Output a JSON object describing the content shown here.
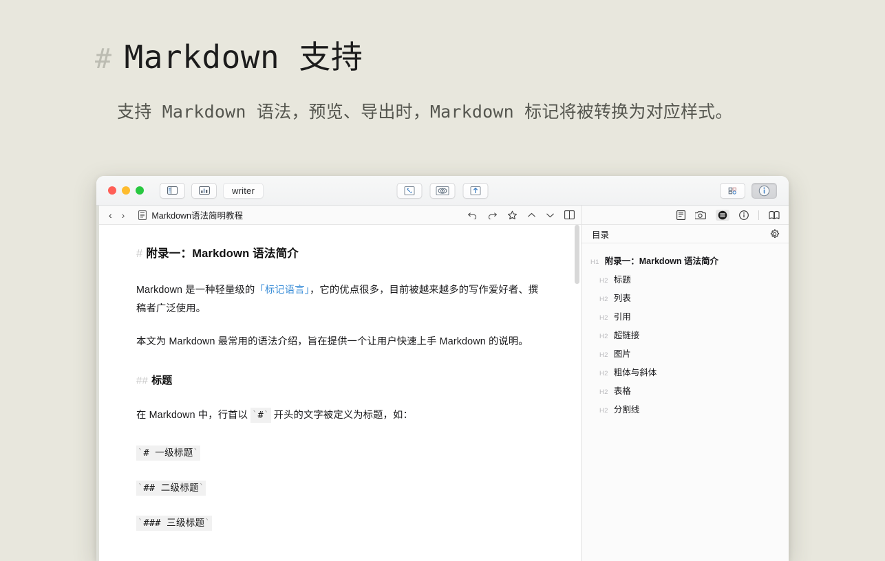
{
  "promo": {
    "hash": "#",
    "title": "Markdown 支持",
    "subtitle": "支持 Markdown 语法，预览、导出时，Markdown 标记将被转换为对应样式。"
  },
  "titlebar": {
    "traffic_lights": [
      {
        "name": "close",
        "color": "#ff5f57"
      },
      {
        "name": "minimize",
        "color": "#febc2e"
      },
      {
        "name": "zoom",
        "color": "#28c840"
      }
    ],
    "left_buttons": [
      {
        "icon": "sidebar-toggle-icon",
        "label": ""
      },
      {
        "icon": "statistics-icon",
        "label": ""
      }
    ],
    "mode_label": "writer",
    "center_buttons": [
      {
        "icon": "focus-mode-icon"
      },
      {
        "icon": "preview-eye-icon"
      },
      {
        "icon": "export-upload-icon"
      }
    ],
    "right_buttons": [
      {
        "icon": "grid-layout-icon",
        "active": false
      },
      {
        "icon": "info-circle-icon",
        "active": true
      }
    ]
  },
  "doc_toolbar": {
    "back_arrow": "‹",
    "forward_arrow": "›",
    "doc_icon": "document-icon",
    "doc_title": "Markdown语法简明教程",
    "tools": [
      {
        "icon": "undo-icon"
      },
      {
        "icon": "redo-icon"
      },
      {
        "icon": "star-icon"
      },
      {
        "icon": "chevron-up-icon"
      },
      {
        "icon": "chevron-down-icon"
      },
      {
        "icon": "split-panel-icon"
      }
    ]
  },
  "toc_toolbar": {
    "tools": [
      {
        "icon": "note-icon",
        "active": false
      },
      {
        "icon": "camera-icon",
        "active": false
      },
      {
        "icon": "outline-icon",
        "active": true
      },
      {
        "icon": "info-circle-icon",
        "active": false
      },
      {
        "icon": "map-icon",
        "active": false
      }
    ]
  },
  "toc": {
    "title": "目录",
    "settings_icon": "gear-icon",
    "items": [
      {
        "tag": "H1",
        "label": "附录一：Markdown 语法简介",
        "level": 1
      },
      {
        "tag": "H2",
        "label": "标题",
        "level": 2
      },
      {
        "tag": "H2",
        "label": "列表",
        "level": 2
      },
      {
        "tag": "H2",
        "label": "引用",
        "level": 2
      },
      {
        "tag": "H2",
        "label": "超链接",
        "level": 2
      },
      {
        "tag": "H2",
        "label": "图片",
        "level": 2
      },
      {
        "tag": "H2",
        "label": "粗体与斜体",
        "level": 2
      },
      {
        "tag": "H2",
        "label": "表格",
        "level": 2
      },
      {
        "tag": "H2",
        "label": "分割线",
        "level": 2
      }
    ]
  },
  "editor": {
    "h1_mark": "#",
    "h1_text": "附录一：Markdown 语法简介",
    "p1_before": "Markdown 是一种轻量级的",
    "p1_link": "「标记语言」",
    "p1_after": "，它的优点很多，目前被越来越多的写作爱好者、撰稿者广泛使用。",
    "p2": "本文为 Markdown 最常用的语法介绍，旨在提供一个让用户快速上手 Markdown 的说明。",
    "h2_mark": "##",
    "h2_text": "标题",
    "p3_before": "在 Markdown 中，行首以 ",
    "p3_code": "#",
    "p3_after": " 开头的文字被定义为标题，如：",
    "code1": "# 一级标题",
    "code2": "## 二级标题",
    "code3": "### 三级标题",
    "backtick": "`",
    "link_color": "#3d8fd8",
    "code_bg": "#f1f1f1"
  }
}
